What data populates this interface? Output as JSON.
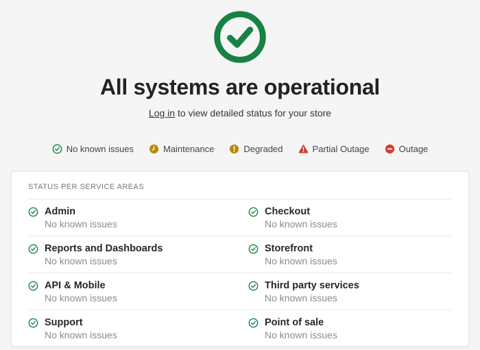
{
  "hero": {
    "icon": "check-circle-icon",
    "title": "All systems are operational",
    "login_link": "Log in",
    "subtitle_rest": " to view detailed status for your store"
  },
  "legend": {
    "items": [
      {
        "icon": "check-circle-icon",
        "label": "No known issues"
      },
      {
        "icon": "clock-icon",
        "label": "Maintenance"
      },
      {
        "icon": "exclamation-circle-icon",
        "label": "Degraded"
      },
      {
        "icon": "warning-triangle-icon",
        "label": "Partial Outage"
      },
      {
        "icon": "minus-circle-icon",
        "label": "Outage"
      }
    ]
  },
  "card": {
    "header": "STATUS PER SERVICE AREAS",
    "services": [
      {
        "icon": "check-circle-icon",
        "name": "Admin",
        "status": "No known issues"
      },
      {
        "icon": "check-circle-icon",
        "name": "Checkout",
        "status": "No known issues"
      },
      {
        "icon": "check-circle-icon",
        "name": "Reports and Dashboards",
        "status": "No known issues"
      },
      {
        "icon": "check-circle-icon",
        "name": "Storefront",
        "status": "No known issues"
      },
      {
        "icon": "check-circle-icon",
        "name": "API & Mobile",
        "status": "No known issues"
      },
      {
        "icon": "check-circle-icon",
        "name": "Third party services",
        "status": "No known issues"
      },
      {
        "icon": "check-circle-icon",
        "name": "Support",
        "status": "No known issues"
      },
      {
        "icon": "check-circle-icon",
        "name": "Point of sale",
        "status": "No known issues"
      }
    ]
  },
  "colors": {
    "ok_green": "#178244",
    "maintenance_amber": "#b98900",
    "degraded_amber": "#b98900",
    "outage_red": "#d33a2f",
    "page_background": "#f5f5f5",
    "card_background": "#ffffff"
  }
}
